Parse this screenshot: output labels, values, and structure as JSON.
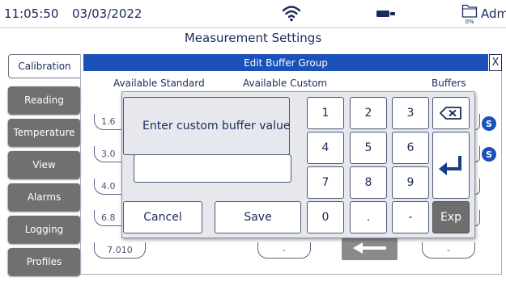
{
  "status": {
    "time": "11:05:50",
    "date": "03/03/2022",
    "storage_percent": "0%",
    "user": "Admir",
    "icons": [
      "wifi-icon",
      "probe-icon",
      "storage-icon"
    ]
  },
  "page_title": "Measurement Settings",
  "tabs": {
    "active": "Calibration",
    "items": [
      "Reading",
      "Temperature",
      "View",
      "Alarms",
      "Logging",
      "Profiles"
    ]
  },
  "panel": {
    "title": "Edit Buffer Group",
    "close_label": "X",
    "columns": {
      "standard": "Available Standard",
      "custom": "Available Custom",
      "buffers": "Buffers"
    },
    "standard_items": [
      "1.6",
      "3.0",
      "4.0",
      "6.8",
      "7.010"
    ],
    "custom_items": [
      "-"
    ],
    "buffer_items": [
      "-"
    ],
    "badge_label": "S"
  },
  "dialog": {
    "prompt": "Enter custom buffer value",
    "input_value": "",
    "keys": [
      "1",
      "2",
      "3",
      "4",
      "5",
      "6",
      "7",
      "8",
      "9",
      "0",
      ".",
      "-"
    ],
    "cancel_label": "Cancel",
    "save_label": "Save",
    "exp_label": "Exp"
  },
  "colors": {
    "header_blue": "#1a50b8",
    "tab_gray": "#707070",
    "text_navy": "#1a2a5a",
    "dialog_bg": "#e6e8ee"
  }
}
